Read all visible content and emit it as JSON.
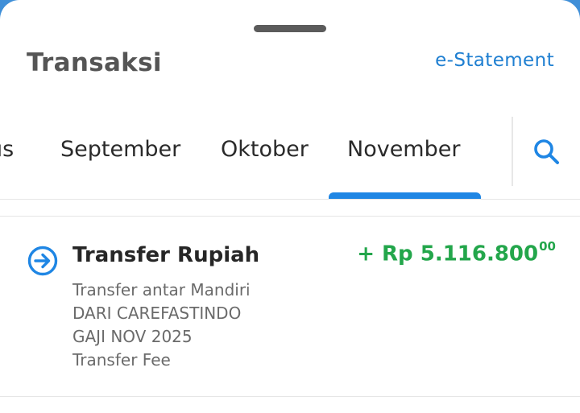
{
  "header": {
    "title": "Transaksi",
    "estatement_label": "e-Statement"
  },
  "months": {
    "items": [
      "us",
      "September",
      "Oktober",
      "November"
    ],
    "selected": "November"
  },
  "icons": {
    "search": "search-icon",
    "transfer": "transfer-in-icon"
  },
  "colors": {
    "accent": "#1f86e4",
    "credit": "#23a64b",
    "brand_bg": "#3f8fd8"
  },
  "transactions": [
    {
      "title": "Transfer Rupiah",
      "amount_main": "+ Rp 5.116.800",
      "amount_cents": "00",
      "details": [
        "Transfer antar Mandiri",
        "DARI CAREFASTINDO",
        "GAJI NOV 2025",
        "Transfer Fee"
      ]
    }
  ]
}
